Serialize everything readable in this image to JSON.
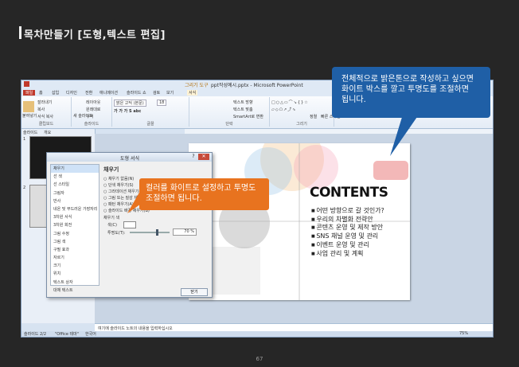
{
  "page": {
    "title": "목차만들기 [도형,텍스트 편집]",
    "page_number": "67"
  },
  "window": {
    "title": "ppt작성예시.pptx - Microsoft PowerPoint",
    "context_tab_group": "그리기 도구",
    "tabs": [
      "파일",
      "홈",
      "삽입",
      "디자인",
      "전환",
      "애니메이션",
      "슬라이드 쇼",
      "검토",
      "보기",
      "서식"
    ],
    "ribbon_groups": [
      "클립보드",
      "슬라이드",
      "글꼴",
      "단락",
      "그리기",
      "편집"
    ],
    "ribbon_buttons": {
      "paste": "붙여넣기",
      "cut": "잘라내기",
      "copy": "복사",
      "format_painter": "서식 복사",
      "new_slide": "새 슬라이드",
      "layout": "레이아웃",
      "reset": "원래대로",
      "section": "구역",
      "font": "맑은 고딕 (본문)",
      "font_size": "18",
      "text_direction": "텍스트 방향",
      "text_align": "텍스트 맞춤",
      "smartart": "SmartArt로 변환",
      "arrange": "정렬",
      "quick_styles": "빠른 스타일"
    },
    "left_panel_tabs": [
      "슬라이드",
      "개요"
    ],
    "notes_placeholder": "여기에 슬라이드 노트의 내용을 입력하십시오",
    "status": {
      "slide_info": "슬라이드 2/2",
      "theme": "\"Office 테마\"",
      "language": "한국어",
      "zoom": "75%"
    }
  },
  "slide": {
    "heading": "CONTENTS",
    "items": [
      "어떤 방향으로 갈 것인가?",
      "우리의 차별화 전략안",
      "콘텐츠 운영 및 제작 방안",
      "SNS 채널 운영 및 관리",
      "이벤트 운영 및 관리",
      "사업 관리 및 계획"
    ],
    "thumbnails": [
      "1",
      "2"
    ]
  },
  "dialog": {
    "title": "도형 서식",
    "help": "?",
    "close": "✕",
    "nav_items": [
      "채우기",
      "선 색",
      "선 스타일",
      "그림자",
      "반사",
      "네온 및 부드러운 가장자리",
      "3차원 서식",
      "3차원 회전",
      "그림 수정",
      "그림 색",
      "구필 효과",
      "자르기",
      "크기",
      "위치",
      "텍스트 상자",
      "대체 텍스트"
    ],
    "panel_heading": "채우기",
    "options": [
      "채우기 없음(N)",
      "단색 채우기(S)",
      "그라데이션 채우기(G)",
      "그림 또는 질감 채우기(P)",
      "패턴 채우기(A)",
      "슬라이드 배경 채우기(B)"
    ],
    "color_section": "채우기 색",
    "color_label": "색(C)",
    "transparency_label": "투명도(T):",
    "transparency_value": "70 %",
    "transparency_level": 0.7,
    "ok": "닫기"
  },
  "callouts": {
    "blue": [
      "전체적으로 밝은톤으로 작성하고 싶으면",
      "화이트 박스를 깔고 투명도를 조절하면",
      "됩니다."
    ],
    "orange": [
      "컬러를 화이트로 설정하고 투명도",
      "조절하면 됩니다."
    ]
  },
  "colors": {
    "background": "#262626",
    "callout_blue": "#1f5fa6",
    "callout_orange": "#e8731f",
    "file_tab": "#c0392b"
  }
}
